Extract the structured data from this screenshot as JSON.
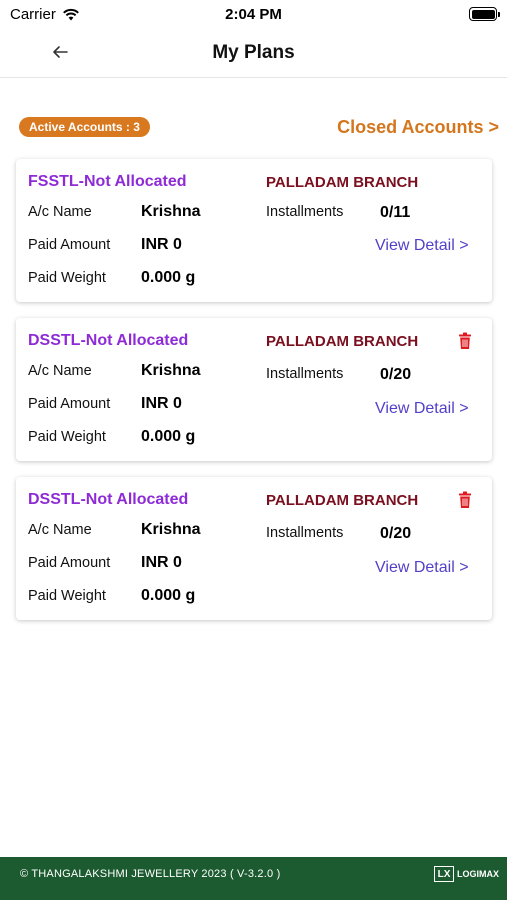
{
  "status": {
    "carrier": "Carrier",
    "time": "2:04 PM"
  },
  "header": {
    "title": "My Plans"
  },
  "summary": {
    "active_label": "Active Accounts : 3",
    "closed_label": "Closed Accounts >"
  },
  "labels": {
    "ac_name": "A/c Name",
    "paid_amount": "Paid Amount",
    "paid_weight": "Paid Weight",
    "installments": "Installments",
    "view_detail": "View Detail >"
  },
  "plans": [
    {
      "title": "FSSTL-Not Allocated",
      "branch": "PALLADAM BRANCH",
      "ac_name": "Krishna",
      "paid_amount": "INR 0",
      "paid_weight": "0.000 g",
      "installments": "0/11",
      "deletable": false
    },
    {
      "title": "DSSTL-Not Allocated",
      "branch": "PALLADAM BRANCH",
      "ac_name": "Krishna",
      "paid_amount": "INR 0",
      "paid_weight": "0.000 g",
      "installments": "0/20",
      "deletable": true
    },
    {
      "title": "DSSTL-Not Allocated",
      "branch": "PALLADAM BRANCH",
      "ac_name": "Krishna",
      "paid_amount": "INR 0",
      "paid_weight": "0.000 g",
      "installments": "0/20",
      "deletable": true
    }
  ],
  "footer": {
    "copyright": "© THANGALAKSHMI JEWELLERY 2023 ( V-3.2.0 )",
    "vendor_mark": "LX",
    "vendor_name": "LOGIMAX"
  },
  "colors": {
    "accent_orange": "#d8781f",
    "plan_title_purple": "#8e2bd6",
    "branch_maroon": "#7a0f1f",
    "link_blue": "#5340c9",
    "delete_red": "#e0191f",
    "footer_green": "#1c5b30"
  },
  "icons": {
    "back": "arrow-left-icon",
    "delete": "trash-icon",
    "wifi": "wifi-icon",
    "battery": "battery-icon"
  }
}
